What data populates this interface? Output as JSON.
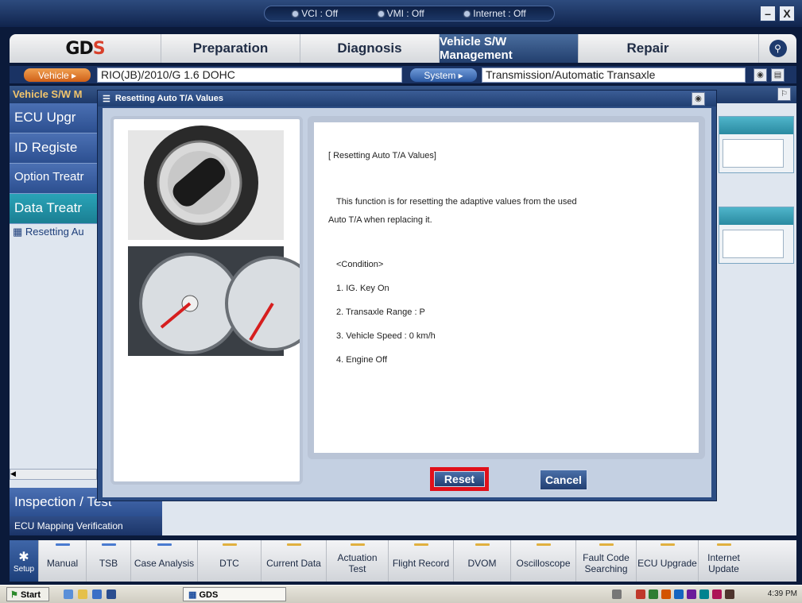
{
  "status": {
    "vci": "VCI : Off",
    "vmi": "VMI : Off",
    "internet": "Internet : Off"
  },
  "window": {
    "minimize": "–",
    "close": "X"
  },
  "nav": {
    "logo_left": "GD",
    "logo_right": "S",
    "tabs": [
      "Preparation",
      "Diagnosis",
      "Vehicle S/W Management",
      "Repair"
    ],
    "active_tab": "Vehicle S/W Management"
  },
  "vehicle_bar": {
    "vehicle_label": "Vehicle",
    "vehicle_value": "RIO(JB)/2010/G 1.6 DOHC",
    "system_label": "System",
    "system_value": "Transmission/Automatic Transaxle"
  },
  "sidebar": {
    "title": "Vehicle S/W M",
    "items": [
      "ECU Upgr",
      "ID Registe",
      "Option Treatr",
      "Data Treatr"
    ],
    "sub_item": "Resetting Au",
    "inspection": "Inspection / Test",
    "ecu_mapping": "ECU Mapping Verification"
  },
  "dialog": {
    "title": "Resetting Auto T/A Values",
    "heading": "[ Resetting Auto T/A Values]",
    "line1": "This function is for resetting the adaptive values from the used",
    "line2": "Auto T/A when replacing it.",
    "condition_title": "<Condition>",
    "conditions": [
      "1. IG. Key On",
      "2. Transaxle Range : P",
      "3. Vehicle Speed : 0 km/h",
      "4. Engine Off"
    ],
    "reset_label": "Reset",
    "cancel_label": "Cancel"
  },
  "toolbar": {
    "setup": "Setup",
    "items": [
      "Manual",
      "TSB",
      "Case Analysis",
      "DTC",
      "Current Data",
      "Actuation Test",
      "Flight Record",
      "DVOM",
      "Oscilloscope",
      "Fault Code Searching",
      "ECU Upgrade",
      "Internet Update"
    ]
  },
  "taskbar": {
    "start": "Start",
    "task": "GDS",
    "clock": "4:39 PM"
  },
  "colors": {
    "accent_blue": "#2c4f90",
    "highlight_red": "#e0101a",
    "logo_red": "#d8402b"
  }
}
